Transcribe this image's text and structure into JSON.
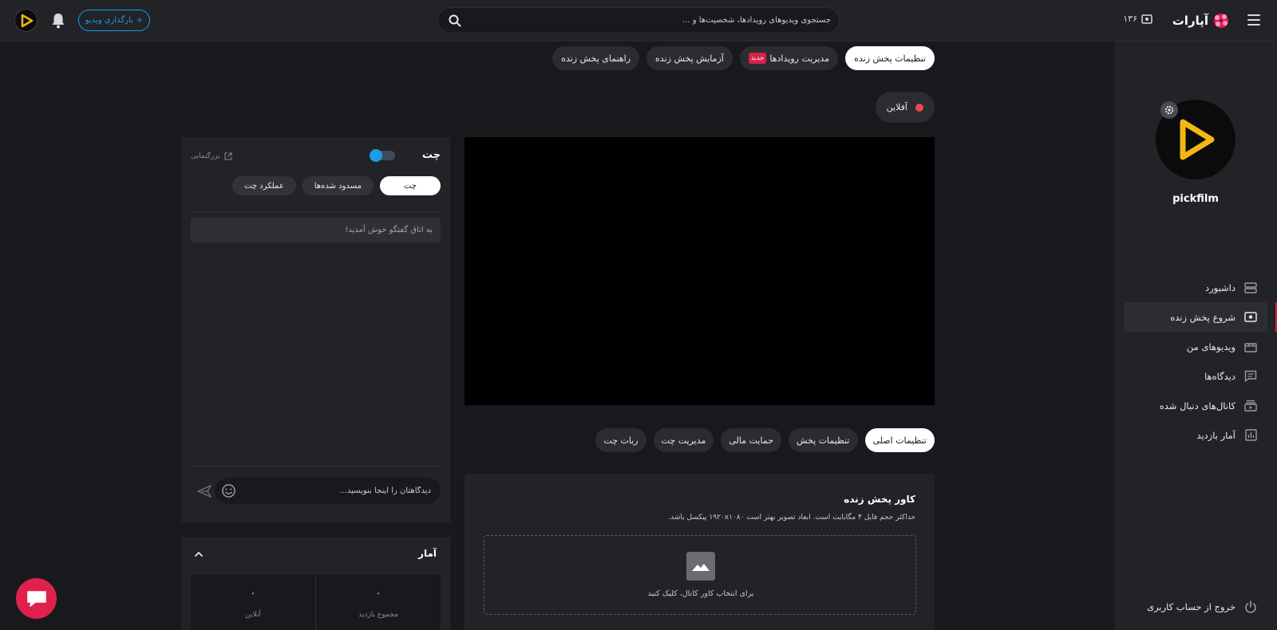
{
  "header": {
    "logo_text": "آپارات",
    "live_count": "۱۳۶",
    "search_placeholder": "جستجوی ویدیوهای رویدادها، شخصیت‌ها و ...",
    "upload_label": "بارگذاری ویدیو",
    "upload_plus": "+"
  },
  "sidebar": {
    "username": "pickfilm",
    "items": [
      {
        "label": "داشبورد",
        "icon": "dashboard-icon"
      },
      {
        "label": "شروع پخش زنده",
        "icon": "live-icon",
        "active": true
      },
      {
        "label": "ویدیوهای من",
        "icon": "videos-icon"
      },
      {
        "label": "دیدگاه‌ها",
        "icon": "comments-icon"
      },
      {
        "label": "کانال‌های دنبال شده",
        "icon": "subscriptions-icon"
      },
      {
        "label": "آمار بازدید",
        "icon": "stats-icon"
      }
    ],
    "logout_label": "خروج از حساب کاربری"
  },
  "top_tabs": [
    {
      "label": "تنظیمات پخش زنده",
      "active": true
    },
    {
      "label": "مدیریت رویدادها",
      "badge": "جدید"
    },
    {
      "label": "آزمایش پخش زنده"
    },
    {
      "label": "راهنمای پخش زنده"
    }
  ],
  "stream_status": "آفلاین",
  "bottom_tabs": [
    {
      "label": "تنظیمات اصلی",
      "active": true
    },
    {
      "label": "تنظیمات پخش"
    },
    {
      "label": "حمایت مالی"
    },
    {
      "label": "مدیریت چت"
    },
    {
      "label": "ربات چت"
    }
  ],
  "cover": {
    "title": "کاور پخش زنده",
    "description": "حداکثر حجم فایل ۴ مگابایت است. ابعاد تصویر بهتر است ۱۹۲۰x۱۰۸۰ پیکسل باشد.",
    "dropzone_text": "برای انتخاب کاور کانال، کلیک کنید"
  },
  "chat": {
    "title": "چت",
    "popout_label": "بزرگنمایی",
    "tabs": [
      {
        "label": "چت",
        "active": true
      },
      {
        "label": "مسدود شده‌ها"
      },
      {
        "label": "عملکرد چت"
      }
    ],
    "welcome_message": "به اتاق گفتگو خوش آمدید!",
    "input_placeholder": "دیدگاهتان را اینجا بنویسید..."
  },
  "stats": {
    "title": "آمار",
    "cells": [
      {
        "value": "۰",
        "label": "مجموع بازدید"
      },
      {
        "value": "۰",
        "label": "آنلاین"
      }
    ]
  },
  "colors": {
    "accent": "#1c9be6",
    "brand": "#d8204a",
    "offline_dot": "#f04452"
  }
}
